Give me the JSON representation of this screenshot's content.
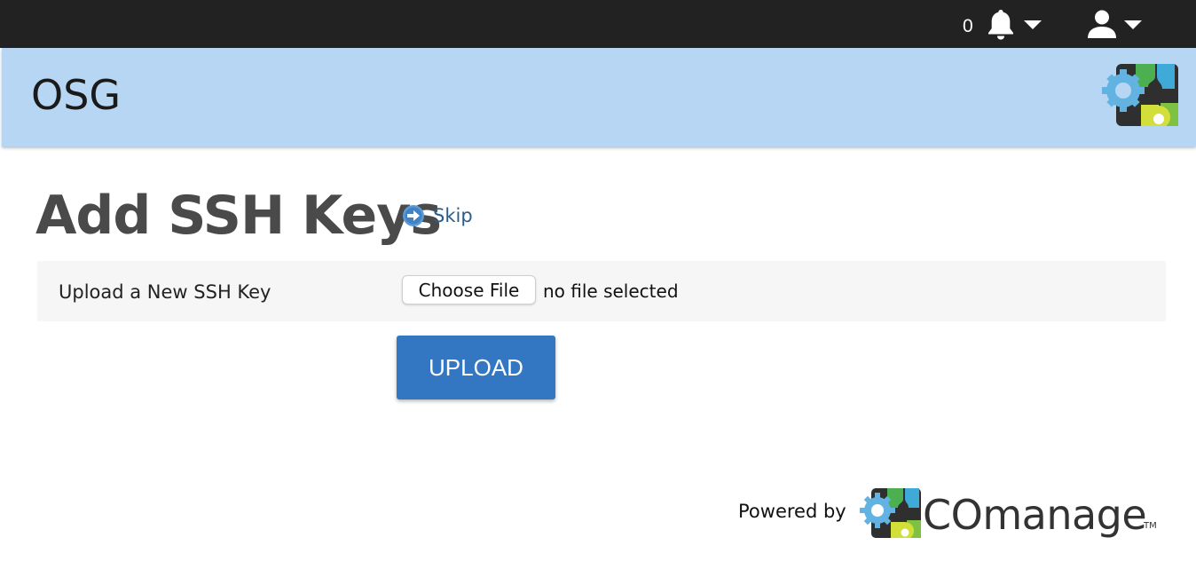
{
  "topbar": {
    "notification_count": "0",
    "icons": {
      "notifications": "bell-icon",
      "user_menu": "user-icon",
      "dropdown": "caret-down-icon"
    }
  },
  "banner": {
    "title": "OSG",
    "logo": "comanage-gears-logo"
  },
  "page": {
    "title": "Add SSH Keys",
    "skip_label": "Skip"
  },
  "form": {
    "label": "Upload a New SSH Key",
    "choose_file_label": "Choose File",
    "file_status": "no file selected",
    "upload_label": "UPLOAD"
  },
  "footer": {
    "powered_by": "Powered by",
    "brand": "COmanage",
    "trademark": "TM"
  },
  "colors": {
    "topbar": "#222222",
    "banner": "#b6d6f4",
    "upload_button": "#3377c3",
    "link": "#2a5d8c"
  }
}
